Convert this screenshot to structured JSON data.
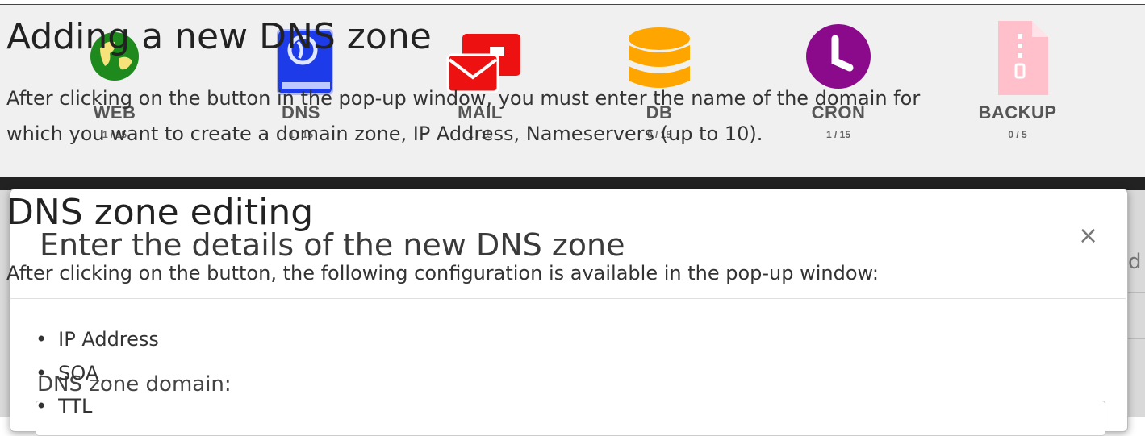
{
  "panel": {
    "services": [
      {
        "name": "WEB",
        "count": "1 / 15",
        "color": "#1e8a1e",
        "icon": "globe-icon"
      },
      {
        "name": "DNS",
        "count": "1 / 15",
        "color": "#1d3be8",
        "icon": "dns-book-icon"
      },
      {
        "name": "MAIL",
        "count": "1 / 15",
        "color": "#ee1111",
        "icon": "mail-icon"
      },
      {
        "name": "DB",
        "count": "0 / 15",
        "color": "#ffa500",
        "icon": "database-icon"
      },
      {
        "name": "CRON",
        "count": "1 / 15",
        "color": "#8b0a8b",
        "icon": "clock-icon"
      },
      {
        "name": "BACKUP",
        "count": "0 / 5",
        "color": "#ffc0cb",
        "icon": "archive-file-icon"
      }
    ]
  },
  "modal": {
    "title": "Enter the details of the new DNS zone",
    "close": "×",
    "field_label": "DNS zone domain:",
    "edge_char": "d"
  },
  "doc": {
    "section1": {
      "heading": "Adding a new DNS zone",
      "line1": "After clicking on the button in the pop-up window, you must enter the name of the domain for",
      "line2": "which you want to create a domain zone, IP Address, Nameservers (up to 10)."
    },
    "section2": {
      "heading": "DNS zone editing",
      "intro": "After clicking on the button, the following configuration is available in the pop-up window:",
      "items": [
        "IP Address",
        "SOA",
        "TTL"
      ]
    }
  }
}
